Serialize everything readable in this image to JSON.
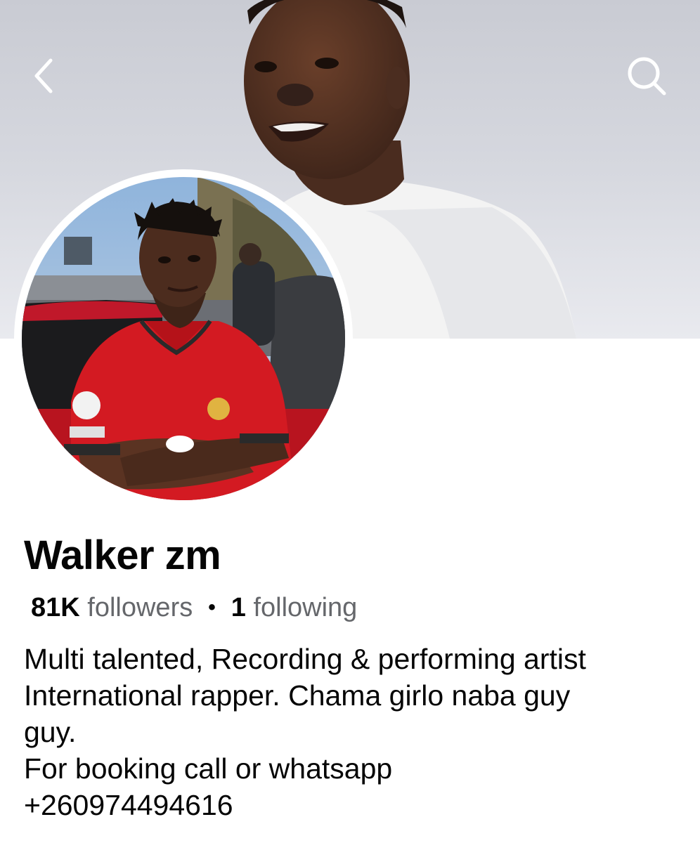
{
  "header": {
    "back_icon": "chevron-left-icon",
    "search_icon": "search-icon"
  },
  "profile": {
    "name": "Walker zm",
    "followers_count": "81K",
    "followers_label": "followers",
    "separator": "•",
    "following_count": "1",
    "following_label": "following",
    "bio_lines": [
      "Multi talented, Recording & performing artist",
      "International rapper. Chama girlo naba guy",
      "guy.",
      "For booking call or whatsapp",
      "+260974494616"
    ]
  }
}
